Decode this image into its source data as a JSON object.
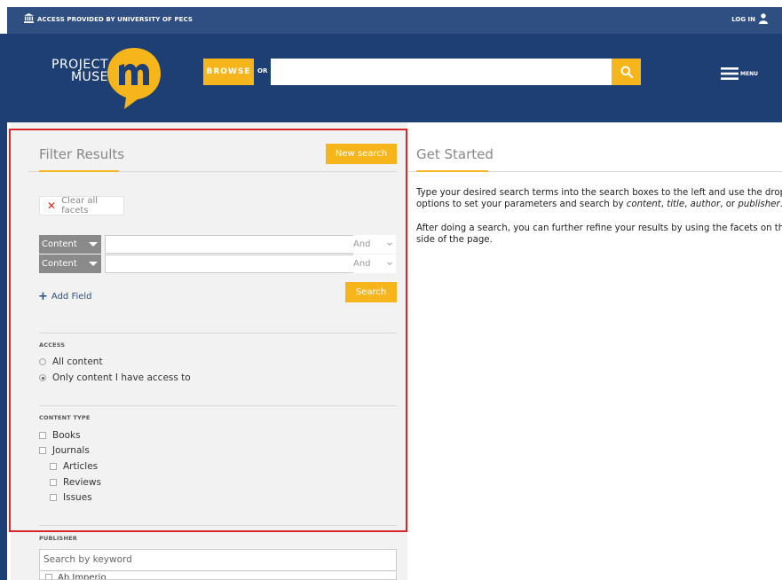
{
  "topbar": {
    "access_text": "ACCESS PROVIDED BY UNIVERSITY OF PECS",
    "login_label": "LOG IN"
  },
  "header": {
    "logo_line1": "PROJECT",
    "logo_line2": "MUSE",
    "browse_label": "BROWSE",
    "or_label": "OR",
    "menu_label": "MENU"
  },
  "filter": {
    "title": "Filter Results",
    "new_search_label": "New search",
    "clear_facets_label": "Clear all facets",
    "rows": [
      {
        "field": "Content",
        "term": "",
        "bool": "And"
      },
      {
        "field": "Content",
        "term": "",
        "bool": "And"
      }
    ],
    "add_field_label": "Add Field",
    "search_label": "Search",
    "access": {
      "heading": "ACCESS",
      "options": [
        "All content",
        "Only content I have access to"
      ],
      "selected": "Only content I have access to"
    },
    "content_type": {
      "heading": "CONTENT TYPE",
      "options": [
        "Books",
        "Journals",
        "Articles",
        "Reviews",
        "Issues"
      ]
    },
    "publisher": {
      "heading": "PUBLISHER",
      "placeholder": "Search by keyword",
      "first_item": "Ab Imperio"
    }
  },
  "get_started": {
    "title": "Get Started",
    "para1_line1": "Type your desired search terms into the search boxes to the left and use the dropdow",
    "para1_line2_a": "options to set your parameters and search by ",
    "para1_line2_content": "content",
    "para1_line2_sep1": ", ",
    "para1_line2_title": "title",
    "para1_line2_sep2": ", ",
    "para1_line2_author": "author",
    "para1_line2_sep3": ", or ",
    "para1_line2_publisher": "publisher",
    "para1_line2_end": ".",
    "para2_line1": "After doing a search, you can further refine your results by using the facets on the left",
    "para2_line2": "side of the page."
  },
  "colors": {
    "accent": "#f5b51b",
    "header_bg": "#1e3f73",
    "topbar_bg": "#2f4f82",
    "highlight_frame": "#d9262b"
  }
}
